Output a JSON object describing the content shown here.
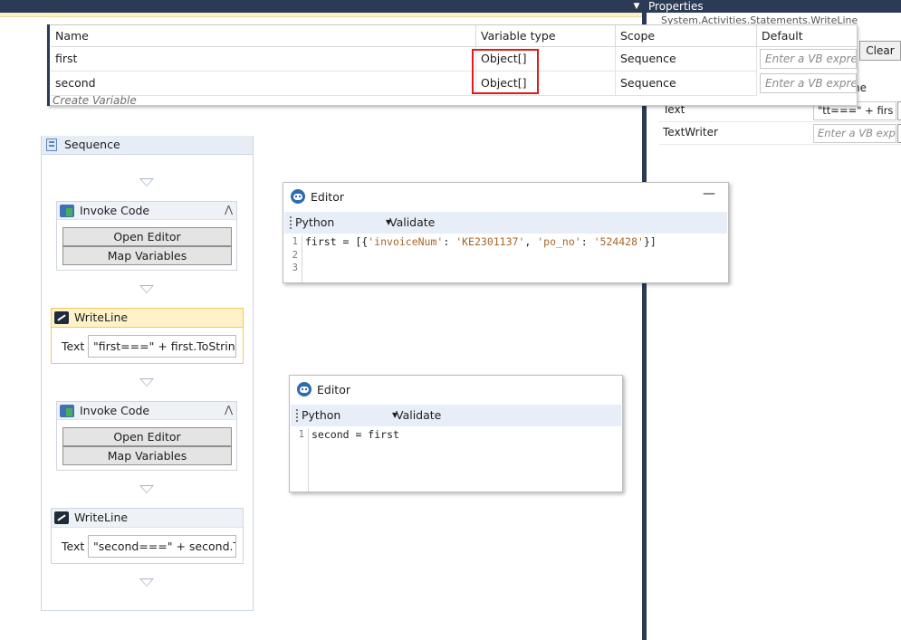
{
  "properties": {
    "title": "Properties",
    "subtitle": "System.Activities.Statements.WriteLine",
    "clear_label": "Clear",
    "name_fragment": "ne",
    "rows": [
      {
        "label": "Text",
        "value": "\"tt===\" + firs"
      },
      {
        "label": "TextWriter",
        "placeholder": "Enter a VB exp"
      }
    ]
  },
  "variables": {
    "headers": [
      "Name",
      "Variable type",
      "Scope",
      "Default"
    ],
    "rows": [
      {
        "name": "first",
        "type": "Object[]",
        "scope": "Sequence",
        "default_placeholder": "Enter a VB express"
      },
      {
        "name": "second",
        "type": "Object[]",
        "scope": "Sequence",
        "default_placeholder": "Enter a VB express"
      }
    ],
    "create_label": "Create Variable"
  },
  "sequence": {
    "title": "Sequence",
    "invoke1": {
      "title": "Invoke Code",
      "open_editor": "Open Editor",
      "map_variables": "Map Variables"
    },
    "writeline1": {
      "title": "WriteLine",
      "text_label": "Text",
      "text_value": "\"first===\" + first.ToString"
    },
    "invoke2": {
      "title": "Invoke Code",
      "open_editor": "Open Editor",
      "map_variables": "Map Variables"
    },
    "writeline2": {
      "title": "WriteLine",
      "text_label": "Text",
      "text_value": "\"second===\" + second.To"
    }
  },
  "editor1": {
    "title": "Editor",
    "language": "Python",
    "validate": "Validate",
    "line_numbers": [
      "1",
      "2",
      "3"
    ],
    "code_line1_a": "first = [{",
    "code_line1_s1": "'invoiceNum'",
    "code_line1_b": ": ",
    "code_line1_s2": "'KE2301137'",
    "code_line1_c": ", ",
    "code_line1_s3": "'po_no'",
    "code_line1_d": ": ",
    "code_line1_s4": "'524428'",
    "code_line1_e": "}]"
  },
  "editor2": {
    "title": "Editor",
    "language": "Python",
    "validate": "Validate",
    "line_numbers": [
      "1"
    ],
    "code_line1": "second = first"
  },
  "colors": {
    "accent": "#2b3a55",
    "highlight_border": "#e01b1b",
    "writeline_header": "#fff2c9"
  },
  "icons": [
    "collapse-icon",
    "chevron-down-icon",
    "minimize-icon",
    "robot-icon",
    "invoke-code-icon",
    "writeline-icon",
    "sequence-icon",
    "arrow-down-icon"
  ]
}
